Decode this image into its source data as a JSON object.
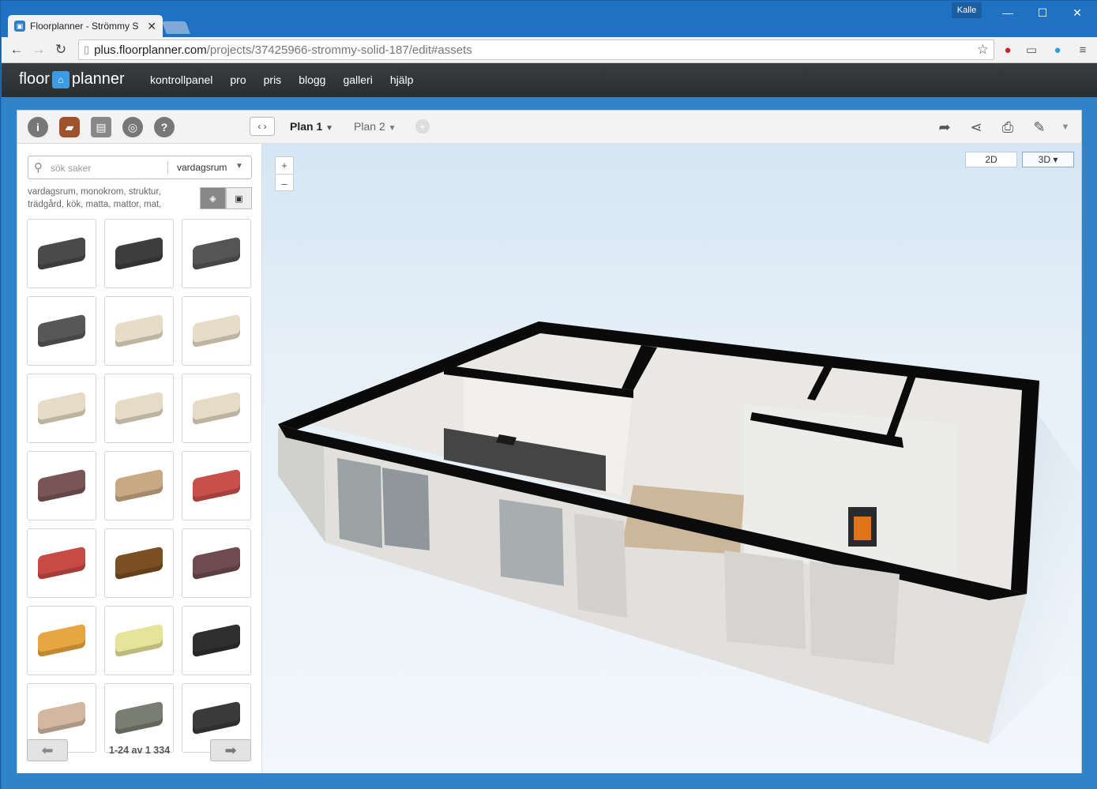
{
  "browser": {
    "tab_title": "Floorplanner - Strömmy S",
    "user_label": "Kalle",
    "url_host": "plus.floorplanner.com",
    "url_path": "/projects/37425966-strommy-solid-187/edit#assets"
  },
  "app": {
    "logo_left": "floor",
    "logo_right": "planner",
    "menu": [
      "kontrollpanel",
      "pro",
      "pris",
      "blogg",
      "galleri",
      "hjälp"
    ]
  },
  "editor": {
    "plans": [
      "Plan 1",
      "Plan 2"
    ],
    "view_modes": {
      "two_d": "2D",
      "three_d": "3D ▾"
    },
    "zoom_in": "+",
    "zoom_out": "–"
  },
  "library": {
    "search_placeholder": "sök saker",
    "category": "vardagsrum",
    "tags_line1": "vardagsrum, monokrom, struktur,",
    "tags_line2": "trädgård, kök, matta, mattor, mat,",
    "pagination": "1-24 av 1 334",
    "items": [
      {
        "name": "barcelona-chair",
        "color": "#4a4a4a"
      },
      {
        "name": "lounge-chair",
        "color": "#3d3d3d"
      },
      {
        "name": "daybed",
        "color": "#555555"
      },
      {
        "name": "ottoman",
        "color": "#575757"
      },
      {
        "name": "loveseat-beige",
        "color": "#e7dcc6"
      },
      {
        "name": "sofa-beige",
        "color": "#e7dcc6"
      },
      {
        "name": "sofa-long-beige",
        "color": "#e6dbc5"
      },
      {
        "name": "corner-sofa-beige",
        "color": "#e6dbc5"
      },
      {
        "name": "corner-sofa-beige-2",
        "color": "#e6dbc5"
      },
      {
        "name": "sofa-plum",
        "color": "#7a5558"
      },
      {
        "name": "chaise-tan",
        "color": "#c9a884"
      },
      {
        "name": "armchair-red",
        "color": "#c94f4b"
      },
      {
        "name": "sofa-red",
        "color": "#c84a44"
      },
      {
        "name": "armchair-wood",
        "color": "#7b4e23"
      },
      {
        "name": "armchair-plum",
        "color": "#6f4c4f"
      },
      {
        "name": "tub-chair-orange",
        "color": "#e8a640"
      },
      {
        "name": "chaise-yellow",
        "color": "#e6e39a"
      },
      {
        "name": "poang-chair",
        "color": "#2f2f2f"
      },
      {
        "name": "corner-sofa-sand",
        "color": "#d2b8a3"
      },
      {
        "name": "corner-sofa-grey",
        "color": "#7a7d72"
      },
      {
        "name": "sofa-black",
        "color": "#3a3a3a"
      }
    ]
  }
}
